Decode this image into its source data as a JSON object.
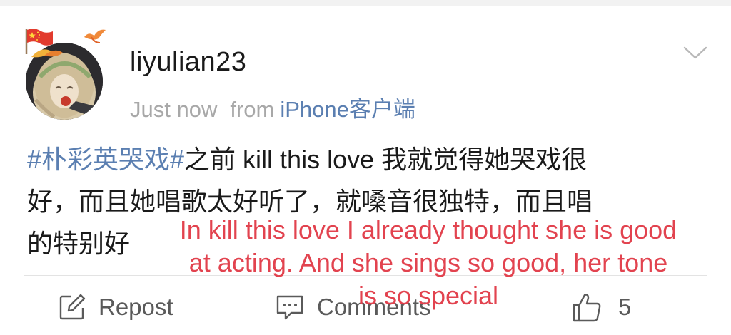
{
  "post": {
    "username": "liyulian23",
    "timestamp": "Just now",
    "from_label": "from",
    "source": "iPhone客户端",
    "hashtag": "#朴彩英哭戏#",
    "body": "之前 kill this love 我就觉得她哭戏很\n好，而且她唱歌太好听了，就嗓音很独特，而且唱\n的特别好",
    "overlay_translation": "In kill this love I already thought she is good\nat acting. And she sings so good, her tone\nis so special"
  },
  "actions": {
    "repost_label": "Repost",
    "comments_label": "Comments",
    "like_count": "5"
  },
  "icons": {
    "menu": "chevron-down-icon",
    "repost": "edit-square-icon",
    "comments": "comment-bubble-icon",
    "like": "thumbs-up-icon",
    "badge": "china-flag-icon"
  },
  "colors": {
    "link": "#5b7fb1",
    "overlay": "#e2434f",
    "meta": "#a8a8a8",
    "action": "#5a5a5a"
  }
}
